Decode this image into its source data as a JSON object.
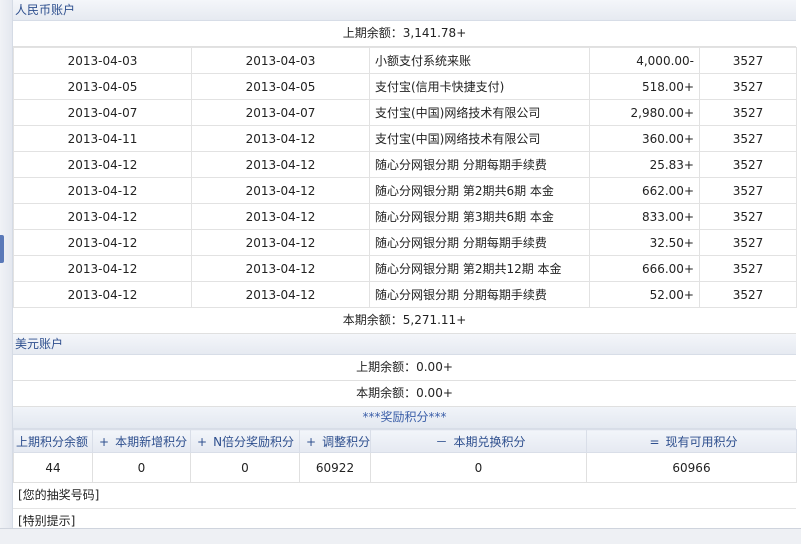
{
  "rmb": {
    "header": "人民币账户",
    "opening_balance": "上期余额：3,141.78+",
    "closing_balance": "本期余额：5,271.11+",
    "rows": [
      {
        "trans_date": "2013-04-03",
        "post_date": "2013-04-03",
        "desc": "小额支付系统来账",
        "amount": "4,000.00-",
        "code": "3527"
      },
      {
        "trans_date": "2013-04-05",
        "post_date": "2013-04-05",
        "desc": "支付宝(信用卡快捷支付)",
        "amount": "518.00+",
        "code": "3527"
      },
      {
        "trans_date": "2013-04-07",
        "post_date": "2013-04-07",
        "desc": "支付宝(中国)网络技术有限公司",
        "amount": "2,980.00+",
        "code": "3527"
      },
      {
        "trans_date": "2013-04-11",
        "post_date": "2013-04-12",
        "desc": "支付宝(中国)网络技术有限公司",
        "amount": "360.00+",
        "code": "3527"
      },
      {
        "trans_date": "2013-04-12",
        "post_date": "2013-04-12",
        "desc": "随心分网银分期 分期每期手续费",
        "amount": "25.83+",
        "code": "3527"
      },
      {
        "trans_date": "2013-04-12",
        "post_date": "2013-04-12",
        "desc": "随心分网银分期 第2期共6期 本金",
        "amount": "662.00+",
        "code": "3527"
      },
      {
        "trans_date": "2013-04-12",
        "post_date": "2013-04-12",
        "desc": "随心分网银分期 第3期共6期 本金",
        "amount": "833.00+",
        "code": "3527"
      },
      {
        "trans_date": "2013-04-12",
        "post_date": "2013-04-12",
        "desc": "随心分网银分期 分期每期手续费",
        "amount": "32.50+",
        "code": "3527"
      },
      {
        "trans_date": "2013-04-12",
        "post_date": "2013-04-12",
        "desc": "随心分网银分期 第2期共12期 本金",
        "amount": "666.00+",
        "code": "3527"
      },
      {
        "trans_date": "2013-04-12",
        "post_date": "2013-04-12",
        "desc": "随心分网银分期 分期每期手续费",
        "amount": "52.00+",
        "code": "3527"
      }
    ]
  },
  "usd": {
    "header": "美元账户",
    "opening_balance": "上期余额：0.00+",
    "closing_balance": "本期余额：0.00+"
  },
  "points": {
    "title": "***奖励积分***",
    "headers": [
      {
        "op": "",
        "label": "上期积分余额"
      },
      {
        "op": "+",
        "label": "本期新增积分"
      },
      {
        "op": "+",
        "label": "N倍分奖励积分"
      },
      {
        "op": "+",
        "label": "调整积分"
      },
      {
        "op": "－",
        "label": "本期兑换积分"
      },
      {
        "op": "=",
        "label": "现有可用积分"
      }
    ],
    "values": [
      "44",
      "0",
      "0",
      "60922",
      "0",
      "60966"
    ]
  },
  "notes": {
    "lottery": "[您的抽奖号码]",
    "tip": "[特别提示]"
  },
  "colors": {
    "header_text": "#2e4f8e",
    "points_title": "#3a5ea8",
    "border": "#e2e2e2"
  }
}
